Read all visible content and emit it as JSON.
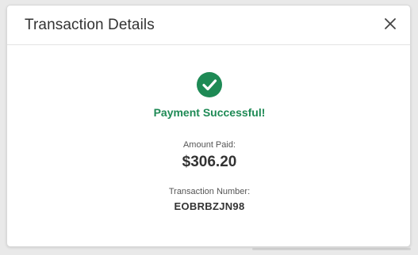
{
  "modal": {
    "title": "Transaction Details",
    "close_icon": "close-icon"
  },
  "status": {
    "icon": "check-circle-icon",
    "text": "Payment Successful!",
    "color": "#1e8a55"
  },
  "amount": {
    "label": "Amount Paid:",
    "value": "$306.20"
  },
  "transaction": {
    "label": "Transaction Number:",
    "value": "EOBRBZJN98"
  }
}
